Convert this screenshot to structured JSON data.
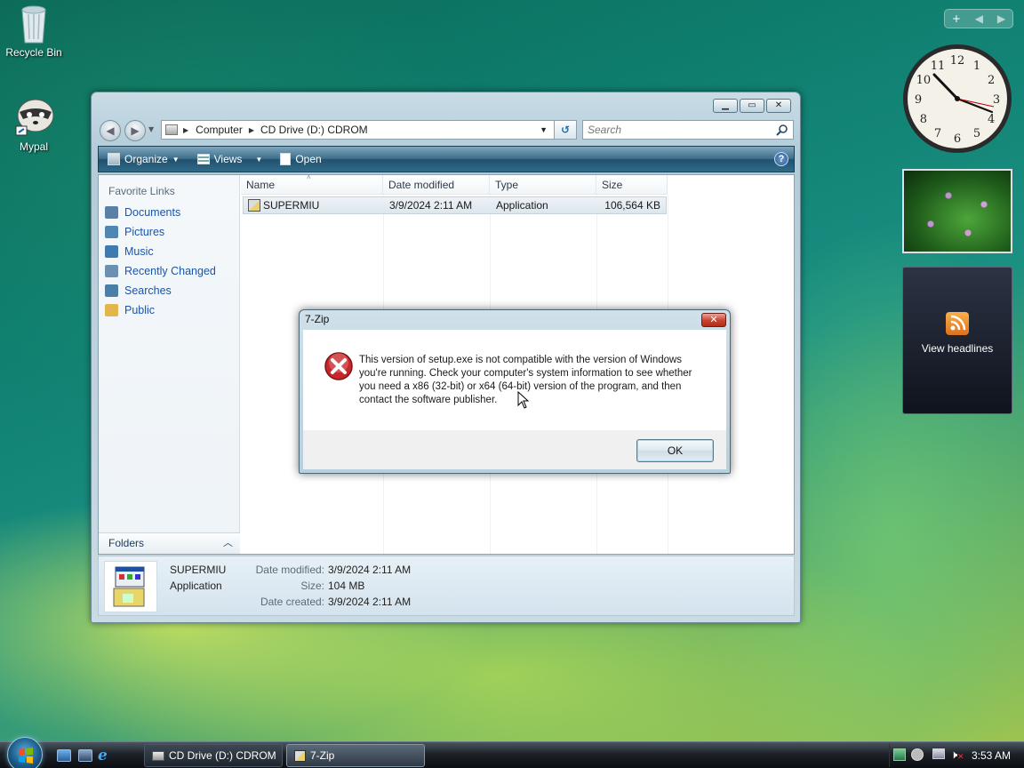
{
  "desktop": {
    "icons": [
      {
        "label": "Recycle Bin",
        "icon": "recycle-bin-icon"
      },
      {
        "label": "Mypal",
        "icon": "mypal-icon"
      }
    ]
  },
  "explorer": {
    "address": {
      "crumbs": [
        "Computer",
        "CD Drive (D:) CDROM"
      ]
    },
    "search_placeholder": "Search",
    "toolbar": {
      "organize": "Organize",
      "views": "Views",
      "open": "Open"
    },
    "sidebar": {
      "title": "Favorite Links",
      "items": [
        {
          "label": "Documents",
          "color": "#5b7fa6"
        },
        {
          "label": "Pictures",
          "color": "#4f87b4"
        },
        {
          "label": "Music",
          "color": "#3d7bb0"
        },
        {
          "label": "Recently Changed",
          "color": "#6d90b0"
        },
        {
          "label": "Searches",
          "color": "#4a7fa8"
        },
        {
          "label": "Public",
          "color": "#e2b64a"
        }
      ],
      "folders_label": "Folders"
    },
    "columns": [
      "Name",
      "Date modified",
      "Type",
      "Size"
    ],
    "files": [
      {
        "name": "SUPERMIU",
        "date": "3/9/2024 2:11 AM",
        "type": "Application",
        "size": "106,564 KB"
      }
    ],
    "details": {
      "name": "SUPERMIU",
      "type": "Application",
      "date_modified_label": "Date modified:",
      "date_modified": "3/9/2024 2:11 AM",
      "size_label": "Size:",
      "size": "104 MB",
      "date_created_label": "Date created:",
      "date_created": "3/9/2024 2:11 AM"
    }
  },
  "dialog": {
    "title": "7-Zip",
    "message": "This version of setup.exe is not compatible with the version of Windows you're running. Check your computer's system information to see whether you need a x86 (32-bit) or x64 (64-bit) version of the program, and then contact the software publisher.",
    "ok_label": "OK",
    "icon": "error-icon"
  },
  "gadgets": {
    "headlines_label": "View headlines",
    "clock_numbers": [
      "12",
      "1",
      "2",
      "3",
      "4",
      "5",
      "6",
      "7",
      "8",
      "9",
      "10",
      "11"
    ]
  },
  "taskbar": {
    "buttons": [
      {
        "label": "CD Drive (D:) CDROM"
      },
      {
        "label": "7-Zip"
      }
    ],
    "time": "3:53 AM"
  }
}
